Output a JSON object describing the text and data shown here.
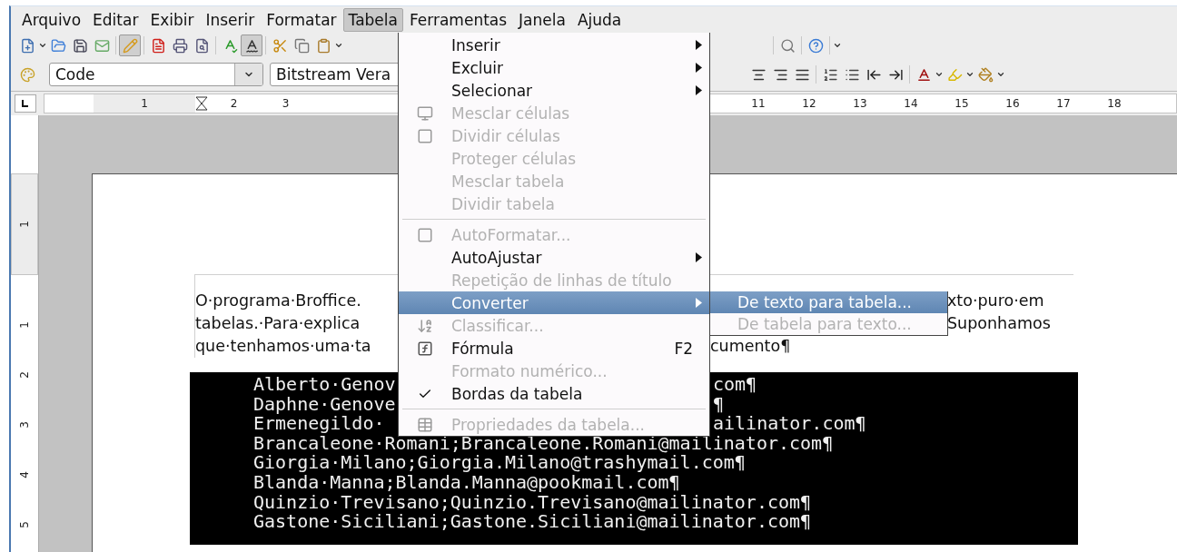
{
  "menu_bar": [
    {
      "label": "Arquivo",
      "selected": false
    },
    {
      "label": "Editar",
      "selected": false
    },
    {
      "label": "Exibir",
      "selected": false
    },
    {
      "label": "Inserir",
      "selected": false
    },
    {
      "label": "Formatar",
      "selected": false
    },
    {
      "label": "Tabela",
      "selected": true
    },
    {
      "label": "Ferramentas",
      "selected": false
    },
    {
      "label": "Janela",
      "selected": false
    },
    {
      "label": "Ajuda",
      "selected": false
    }
  ],
  "standard_toolbar_left": [
    {
      "pressed": false
    },
    {
      "pressed": false
    },
    {
      "pressed": false
    },
    {
      "pressed": false
    },
    {
      "pressed": true
    },
    {
      "pressed": false
    },
    {
      "pressed": false
    },
    {
      "pressed": false
    },
    {
      "pressed": false
    },
    {
      "pressed": true
    },
    {
      "pressed": false
    },
    {
      "pressed": false
    },
    {
      "pressed": false
    }
  ],
  "standard_toolbar_right": [
    {
      "pressed": false
    },
    {
      "pressed": false
    }
  ],
  "formatting_toolbar": {
    "paragraph_style": "Code",
    "font_name": "Bitstream Vera",
    "buttons_right": [
      {
        "pressed": false
      },
      {
        "pressed": false
      },
      {
        "pressed": false
      },
      {
        "pressed": false
      },
      {
        "pressed": false
      },
      {
        "pressed": false
      },
      {
        "pressed": false
      },
      {
        "pressed": false
      },
      {
        "pressed": false
      },
      {
        "pressed": false
      }
    ]
  },
  "ruler": {
    "left_margin_number": "1",
    "left_numbers": [
      "2",
      "3"
    ],
    "right_numbers": [
      "11",
      "12",
      "13",
      "14",
      "15",
      "16",
      "17",
      "18"
    ]
  },
  "vertical_ruler": {
    "top_margin_number": "1",
    "numbers": [
      "1",
      "2",
      "3",
      "4",
      "5"
    ]
  },
  "document": {
    "paragraph_left": [
      "O·programa·Broffice.",
      "tabelas.·Para·explica",
      "que·tenhamos·uma·ta"
    ],
    "paragraph_right": [
      "xto·puro·em",
      "Suponhamos",
      "cumento¶"
    ],
    "code_lines": [
      {
        "left": "Alberto·Genov",
        "right": "com¶"
      },
      {
        "left": "Daphne·Genove",
        "right": "¶"
      },
      {
        "left": "Ermenegildo·",
        "right": "ailinator.com¶"
      },
      {
        "left": "Brancaleone·Romani;Brancaleone.Romani@mailinator.com¶"
      },
      {
        "left": "Giorgia·Milano;Giorgia.Milano@trashymail.com¶"
      },
      {
        "left": "Blanda·Manna;Blanda.Manna@pookmail.com¶"
      },
      {
        "left": "Quinzio·Trevisano;Quinzio.Trevisano@mailinator.com¶"
      },
      {
        "left": "Gastone·Siciliani;Gastone.Siciliani@mailinator.com¶"
      }
    ]
  },
  "table_menu": [
    {
      "kind": "item",
      "label": "Inserir",
      "disabled": false,
      "submenu": true,
      "selected": false
    },
    {
      "kind": "item",
      "label": "Excluir",
      "disabled": false,
      "submenu": true,
      "selected": false
    },
    {
      "kind": "item",
      "label": "Selecionar",
      "disabled": false,
      "submenu": true,
      "selected": false
    },
    {
      "kind": "item",
      "label": "Mesclar células",
      "disabled": true,
      "submenu": false,
      "selected": false
    },
    {
      "kind": "item",
      "label": "Dividir células",
      "disabled": true,
      "submenu": false,
      "selected": false
    },
    {
      "kind": "item",
      "label": "Proteger células",
      "disabled": true,
      "submenu": false,
      "selected": false
    },
    {
      "kind": "item",
      "label": "Mesclar tabela",
      "disabled": true,
      "submenu": false,
      "selected": false
    },
    {
      "kind": "item",
      "label": "Dividir tabela",
      "disabled": true,
      "submenu": false,
      "selected": false
    },
    {
      "kind": "separator"
    },
    {
      "kind": "item",
      "label": "AutoFormatar...",
      "disabled": true,
      "submenu": false,
      "selected": false
    },
    {
      "kind": "item",
      "label": "AutoAjustar",
      "disabled": false,
      "submenu": true,
      "selected": false
    },
    {
      "kind": "item",
      "label": "Repetição de linhas de título",
      "disabled": true,
      "submenu": false,
      "selected": false
    },
    {
      "kind": "item",
      "label": "Converter",
      "disabled": false,
      "submenu": true,
      "selected": true
    },
    {
      "kind": "item",
      "label": "Classificar...",
      "disabled": true,
      "submenu": false,
      "selected": false
    },
    {
      "kind": "item",
      "label": "Fórmula",
      "disabled": false,
      "submenu": false,
      "selected": false,
      "shortcut": "F2"
    },
    {
      "kind": "item",
      "label": "Formato numérico...",
      "disabled": true,
      "submenu": false,
      "selected": false
    },
    {
      "kind": "item",
      "label": "Bordas da tabela",
      "disabled": false,
      "submenu": false,
      "selected": false,
      "checked": true
    },
    {
      "kind": "separator"
    },
    {
      "kind": "item",
      "label": "Propriedades da tabela...",
      "disabled": true,
      "submenu": false,
      "selected": false
    }
  ],
  "convert_submenu": [
    {
      "label": "De texto para tabela...",
      "disabled": false,
      "selected": true
    },
    {
      "label": "De tabela para texto...",
      "disabled": true,
      "selected": false
    }
  ]
}
